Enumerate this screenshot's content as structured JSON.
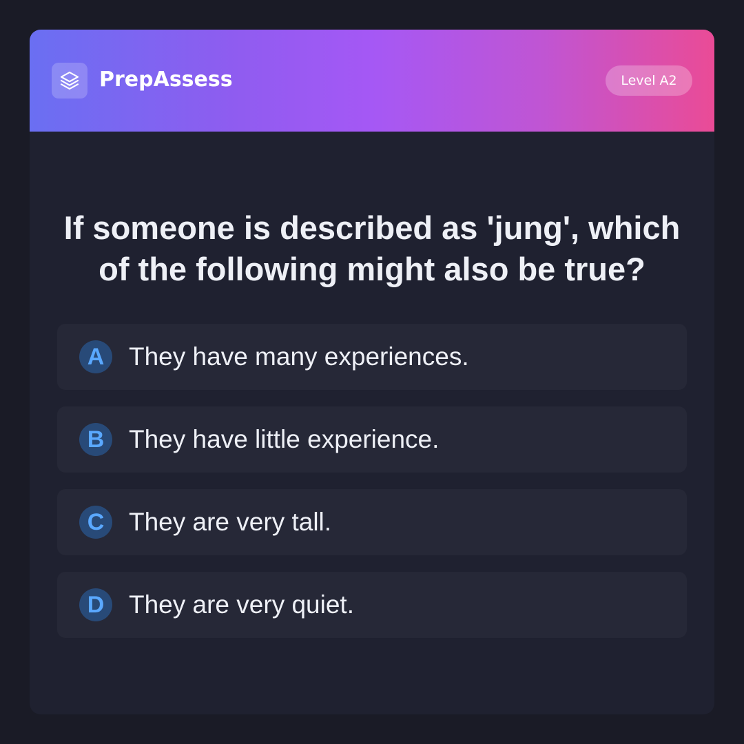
{
  "app": {
    "brand_name": "PrepAssess",
    "logo_icon": "layers-icon",
    "level_badge": "Level A2"
  },
  "question": {
    "text": "If someone is described as 'jung', which of the following might also be true?"
  },
  "options": [
    {
      "letter": "A",
      "text": "They have many experiences."
    },
    {
      "letter": "B",
      "text": "They have little experience."
    },
    {
      "letter": "C",
      "text": "They are very tall."
    },
    {
      "letter": "D",
      "text": "They are very quiet."
    }
  ],
  "colors": {
    "page_background": "#1a1b26",
    "card_background": "#1f2130",
    "option_background": "#262837",
    "header_gradient": [
      "#6a6ff2",
      "#a558f5",
      "#ea4b96"
    ],
    "letter_circle": "#284a78",
    "letter_text": "#5aa8ff",
    "text_primary": "#eef0f6"
  }
}
